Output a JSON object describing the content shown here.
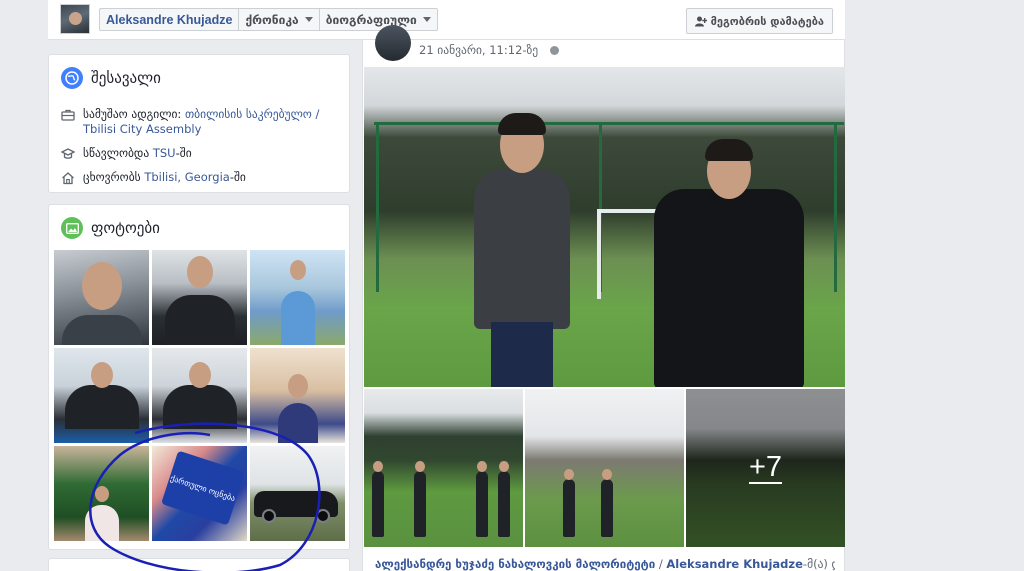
{
  "topbar": {
    "profile_name": "Aleksandre Khujadze",
    "menu_timeline": "ქრონიკა",
    "menu_more": "ბიოგრაფიული",
    "add_friend_label": "მეგობრის დამატება"
  },
  "intro": {
    "title": "შესავალი",
    "work_prefix": "სამუშაო ადგილი: ",
    "work_place": "თბილისის საკრებულო / Tbilisi City Assembly",
    "study_prefix": "სწავლობდა ",
    "study_place": "TSU",
    "study_suffix": "-ში",
    "lives_prefix": "ცხოვრობს ",
    "lives_place": "Tbilisi, Georgia",
    "lives_suffix": "-ში"
  },
  "photos": {
    "title": "ფოტოები",
    "banner_text": "ქართული ოცნება"
  },
  "post": {
    "timestamp": "21 იანვარი, 11:12-ზე",
    "more_count": "+7",
    "caption_link": "ალექსანდრე ხუჯაძე ნახალოვკის მალორიტეტი",
    "caption_separator": " / ",
    "caption_name": "Aleksandre Khujadze",
    "caption_suffix": "-მ(ა) დაამატა"
  },
  "colors": {
    "link": "#385898",
    "page_bg": "#e9ebee",
    "scribble": "#1a1fb5"
  },
  "icons": [
    "globe-icon",
    "briefcase-icon",
    "graduation-cap-icon",
    "home-icon",
    "photo-icon",
    "add-friend-icon",
    "caret-down-icon"
  ]
}
